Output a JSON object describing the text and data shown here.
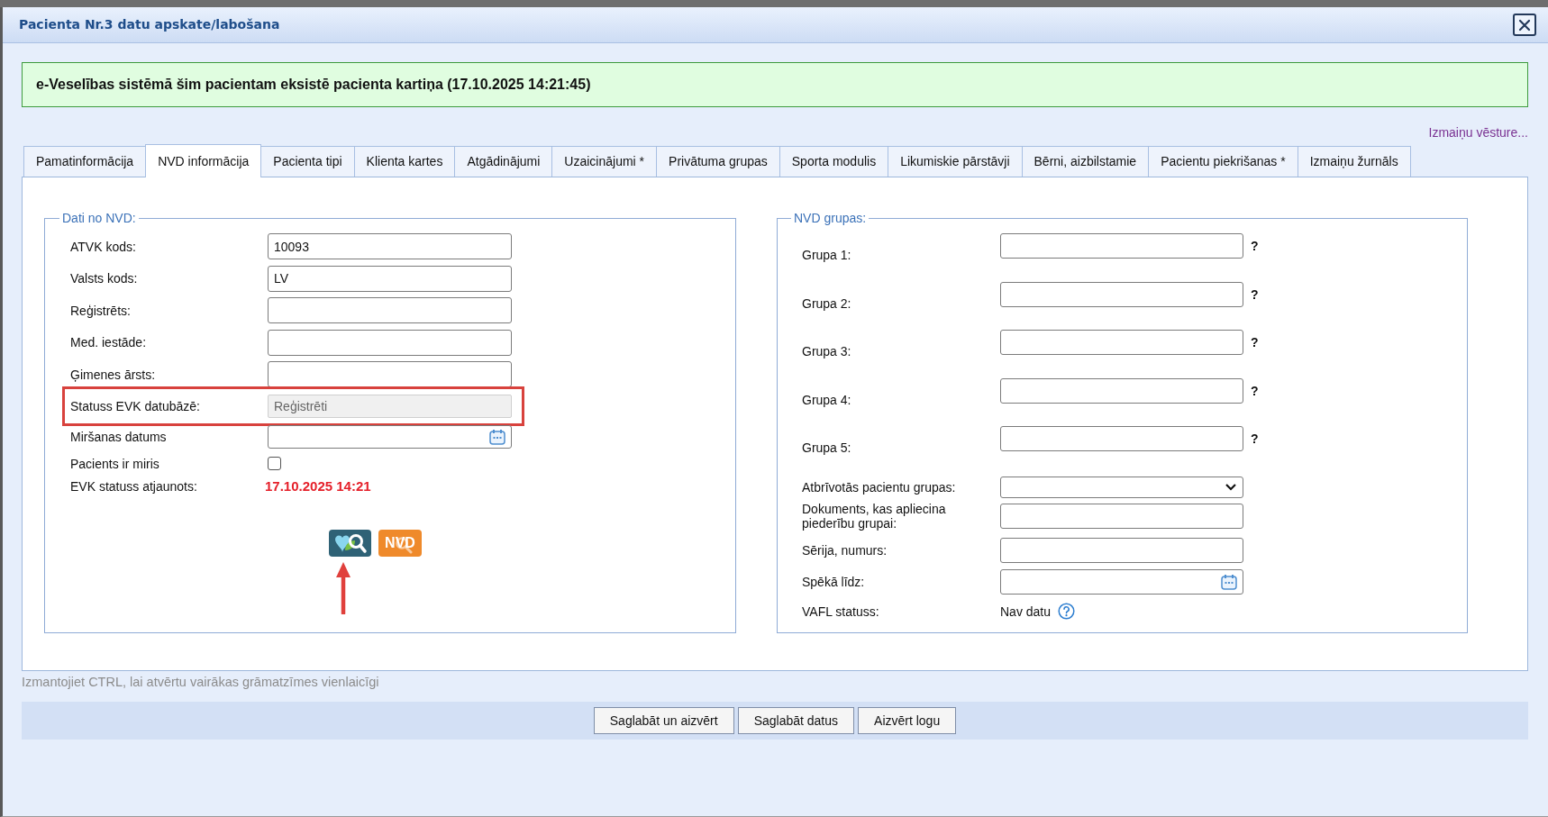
{
  "window": {
    "title": "Pacienta Nr.3 datu apskate/labošana"
  },
  "banner": {
    "text": "e-Veselības sistēmā šim pacientam eksistē pacienta kartiņa (17.10.2025 14:21:45)"
  },
  "history_link": "Izmaiņu vēsture...",
  "tabs": [
    {
      "label": "Pamatinformācija",
      "selected": false
    },
    {
      "label": "NVD informācija",
      "selected": true
    },
    {
      "label": "Pacienta tipi",
      "selected": false
    },
    {
      "label": "Klienta kartes",
      "selected": false
    },
    {
      "label": "Atgādinājumi",
      "selected": false
    },
    {
      "label": "Uzaicinājumi *",
      "selected": false
    },
    {
      "label": "Privātuma grupas",
      "selected": false
    },
    {
      "label": "Sporta modulis",
      "selected": false
    },
    {
      "label": "Likumiskie pārstāvji",
      "selected": false
    },
    {
      "label": "Bērni, aizbilstamie",
      "selected": false
    },
    {
      "label": "Pacientu piekrišanas *",
      "selected": false
    },
    {
      "label": "Izmaiņu žurnāls",
      "selected": false
    }
  ],
  "nvd_data": {
    "legend": "Dati no NVD:",
    "fields": [
      {
        "kind": "text",
        "label": "ATVK kods:",
        "value": "10093",
        "highlighted": false
      },
      {
        "kind": "text",
        "label": "Valsts kods:",
        "value": "LV",
        "highlighted": false
      },
      {
        "kind": "text",
        "label": "Reģistrēts:",
        "highlighted": false
      },
      {
        "kind": "text",
        "label": "Med. iestāde:",
        "highlighted": false
      },
      {
        "kind": "text",
        "label": "Ģimenes ārsts:",
        "highlighted": false
      },
      {
        "kind": "readonly",
        "label": "Statuss EVK datubāzē:",
        "value": "Reģistrēti",
        "highlighted": true
      },
      {
        "kind": "date",
        "label": "Miršanas datums",
        "highlighted": false
      },
      {
        "kind": "checkbox",
        "label": "Pacients ir miris",
        "checked": false,
        "highlighted": false
      },
      {
        "kind": "timestamp",
        "label": "EVK statuss atjaunots:",
        "value": "17.10.2025 14:21",
        "highlighted": false
      }
    ],
    "actions": [
      {
        "kind": "evk_search",
        "pointed": true
      },
      {
        "kind": "nvd_search",
        "label": "NVD",
        "pointed": false
      }
    ]
  },
  "nvd_groups": {
    "legend": "NVD grupas:",
    "groups": [
      {
        "label": "Grupa 1:",
        "help": "?"
      },
      {
        "label": "Grupa 2:",
        "help": "?"
      },
      {
        "label": "Grupa 3:",
        "help": "?"
      },
      {
        "label": "Grupa 4:",
        "help": "?"
      },
      {
        "label": "Grupa 5:",
        "help": "?"
      }
    ],
    "fields": [
      {
        "kind": "select",
        "label": "Atbrīvotās pacientu grupas:"
      },
      {
        "kind": "text",
        "label": "Dokuments, kas apliecina piederību grupai:"
      },
      {
        "kind": "text",
        "label": "Sērija, numurs:"
      },
      {
        "kind": "date",
        "label": "Spēkā līdz:"
      },
      {
        "kind": "status",
        "label": "VAFL statuss:",
        "value": "Nav datu"
      }
    ]
  },
  "footer": {
    "hint": "Izmantojiet CTRL, lai atvērtu vairākas grāmatzīmes vienlaicīgi",
    "buttons": [
      "Saglabāt un aizvērt",
      "Saglabāt datus",
      "Aizvērt logu"
    ]
  }
}
